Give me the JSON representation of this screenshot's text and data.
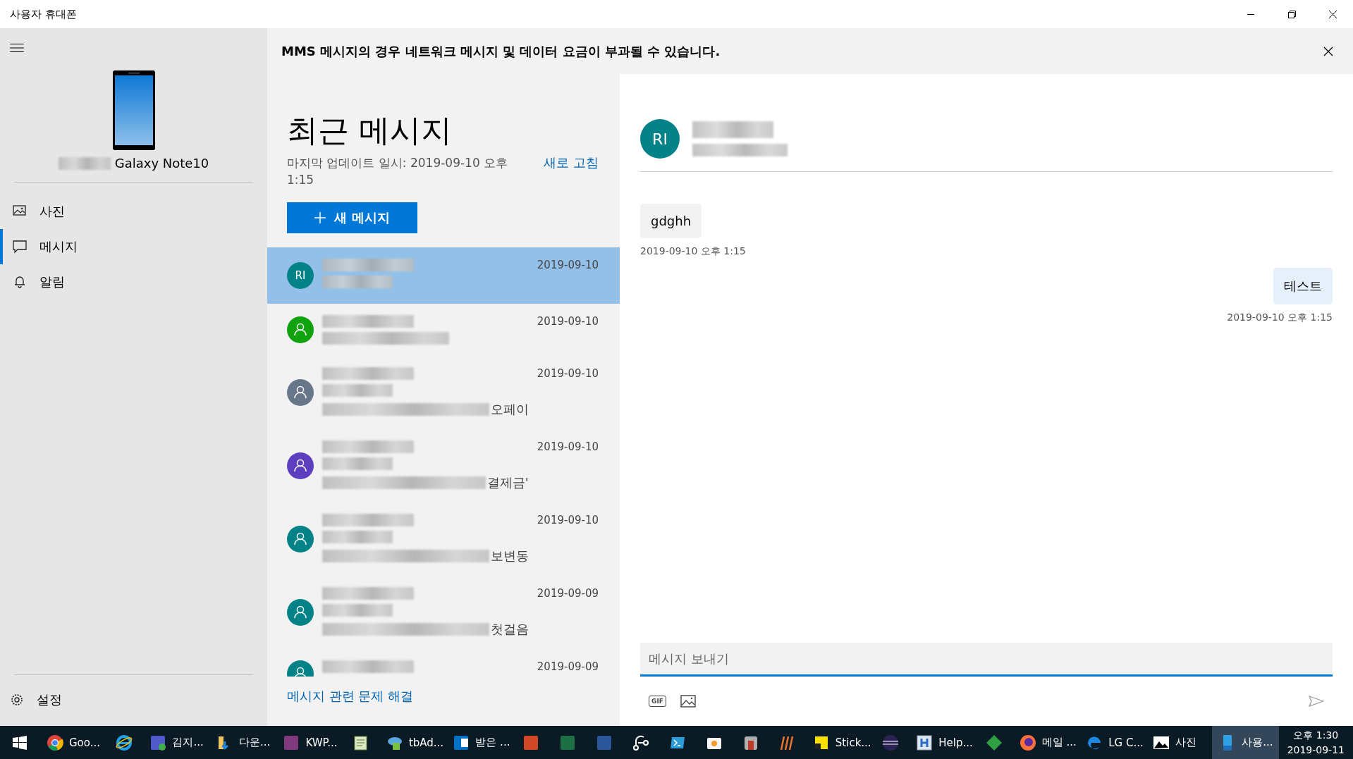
{
  "window": {
    "title": "사용자 휴대폰"
  },
  "sidebar": {
    "device_name": "Galaxy Note10",
    "nav": [
      {
        "label": "사진",
        "kind": "photos",
        "selected": false
      },
      {
        "label": "메시지",
        "kind": "message",
        "selected": true
      },
      {
        "label": "알림",
        "kind": "bell",
        "selected": false
      }
    ],
    "settings": "설정"
  },
  "banner": {
    "text": "MMS 메시지의 경우 네트워크 메시지 및 데이터 요금이 부과될 수 있습니다."
  },
  "message_list": {
    "heading": "최근 메시지",
    "updated": "마지막 업데이트 일시: 2019-09-10 오후 1:15",
    "refresh": "새로 고침",
    "new_button": "새 메시지",
    "conversations": [
      {
        "kind": "initials",
        "initials": "RI",
        "color": "#038387",
        "date": "2019-09-10",
        "selected": true
      },
      {
        "kind": "person",
        "color": "#10a30f",
        "date": "2019-09-10",
        "selected": false
      },
      {
        "kind": "person",
        "color": "#68768a",
        "date": "2019-09-10",
        "preview_tail": "오페이",
        "selected": false
      },
      {
        "kind": "person",
        "color": "#5c3ebe",
        "date": "2019-09-10",
        "preview_tail": "결제금'",
        "selected": false
      },
      {
        "kind": "person",
        "color": "#038387",
        "date": "2019-09-10",
        "preview_tail": "보변동",
        "selected": false
      },
      {
        "kind": "person",
        "color": "#038387",
        "date": "2019-09-09",
        "preview_tail": "첫걸음",
        "selected": false
      },
      {
        "kind": "person",
        "color": "#038387",
        "date": "2019-09-09",
        "selected": false
      }
    ],
    "troubleshoot": "메시지 관련 문제 해결"
  },
  "conversation": {
    "avatar": {
      "initials": "RI",
      "color": "#038387"
    },
    "messages": [
      {
        "kind": "incoming",
        "text": "gdghh",
        "time": "2019-09-10 오후 1:15"
      },
      {
        "kind": "outgoing",
        "text": "테스트",
        "time": "2019-09-10 오후 1:15"
      }
    ],
    "composer": {
      "placeholder": "메시지 보내기",
      "gif_label": "GIF"
    }
  },
  "taskbar": {
    "items": [
      {
        "kind": "chrome",
        "label": "Goo...",
        "active": false
      },
      {
        "kind": "ie",
        "active": false
      },
      {
        "kind": "teams",
        "label": "김지...",
        "active": false
      },
      {
        "kind": "folder",
        "label": "다운...",
        "active": false
      },
      {
        "kind": "onenote",
        "label": "KWP...",
        "active": false
      },
      {
        "kind": "notepad",
        "active": false
      },
      {
        "kind": "cloud",
        "label": "tbAd...",
        "active": false
      },
      {
        "kind": "outlook",
        "label": "받은 ...",
        "active": false
      },
      {
        "kind": "powerpoint",
        "active": false
      },
      {
        "kind": "excel",
        "active": false
      },
      {
        "kind": "word",
        "active": false
      },
      {
        "kind": "share",
        "active": false
      },
      {
        "kind": "terminal",
        "active": false
      },
      {
        "kind": "camera",
        "active": false
      },
      {
        "kind": "castle",
        "active": false
      },
      {
        "kind": "stripes",
        "active": false
      },
      {
        "kind": "sticky",
        "label": "Stick...",
        "active": false
      },
      {
        "kind": "eclipse",
        "active": false
      },
      {
        "kind": "help",
        "label": "Help...",
        "active": false
      },
      {
        "kind": "diamond",
        "active": false
      },
      {
        "kind": "firefox",
        "label": "메일 ...",
        "active": false
      },
      {
        "kind": "edge",
        "label": "LG C...",
        "active": false
      },
      {
        "kind": "picture",
        "label": "사진",
        "active": false
      },
      {
        "kind": "phone",
        "label": "사용...",
        "active": true
      }
    ],
    "time": "오후 1:30",
    "date": "2019-09-11"
  }
}
